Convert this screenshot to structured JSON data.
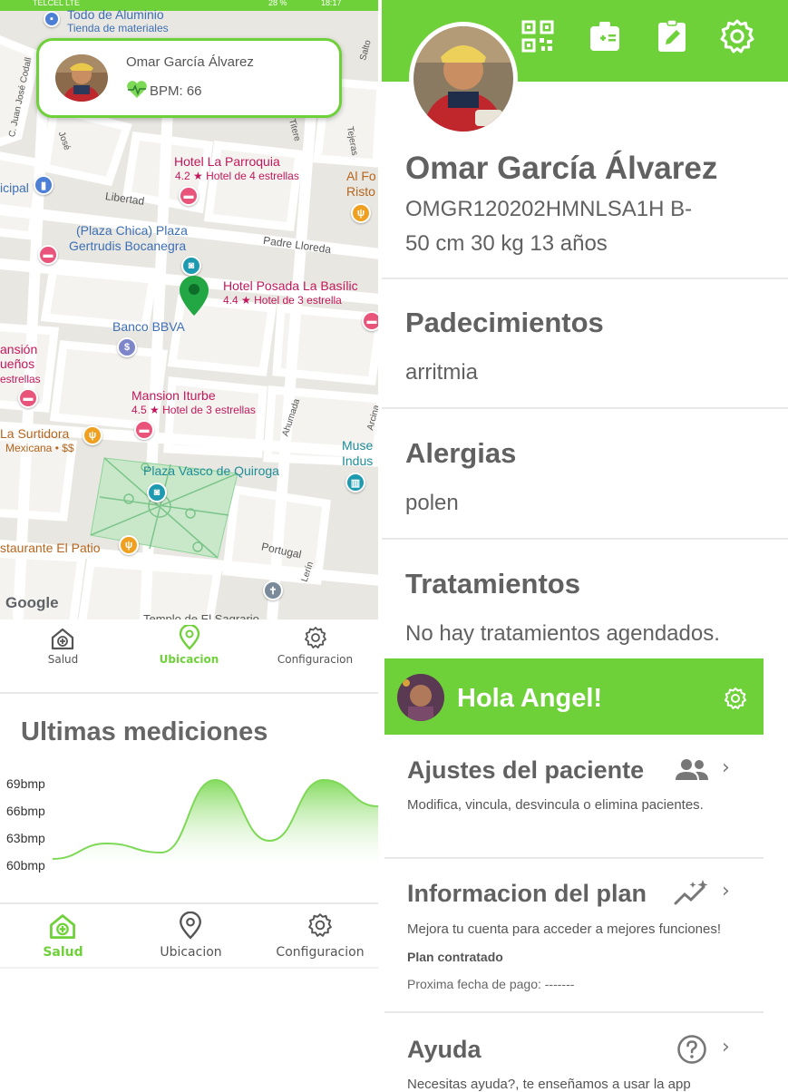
{
  "status_bar": {
    "carrier": "TELCEL LTE",
    "battery": "28 %",
    "time": "18:17"
  },
  "map": {
    "patient_card": {
      "name": "Omar García Álvarez",
      "bpm": "BPM: 66"
    },
    "labels": {
      "todo_aluminio": "Todo de Aluminio",
      "tienda": "Tienda de materiales",
      "hotel_parroquia": "Hotel La Parroquia",
      "hotel_parroquia_sub": "4.2 ★ Hotel de 4 estrellas",
      "al_fo": "Al Fo",
      "risto": "Risto",
      "icipal": "icipal",
      "plaza_chica_1": "(Plaza Chica) Plaza",
      "plaza_chica_2": "Gertrudis Bocanegra",
      "hotel_posada": "Hotel Posada La Basílic",
      "hotel_posada_sub": "4.4 ★ Hotel de 3 estrella",
      "banco": "Banco BBVA",
      "ansion": "ansión",
      "suenos": "ueños",
      "estrellas": "estrellas",
      "mansion": "Mansion Iturbe",
      "mansion_sub": "4.5 ★ Hotel de 3 estrellas",
      "surtidora": "La Surtidora",
      "surtidora_sub": "Mexicana • $$",
      "museo_1": "Muse",
      "museo_2": "Indus",
      "plaza_vasco": "Plaza Vasco de Quiroga",
      "patio": "staurante El Patio",
      "templo": "Templo de El Sagrario",
      "google": "Google"
    },
    "streets": {
      "juan_jose": "C. Juan José Codall",
      "jose": "José",
      "salto": "Salto",
      "titere": "Titere",
      "tejeras": "Tejeras",
      "libertad": "Libertad",
      "padre": "Padre Lloreda",
      "ahumada": "Ahumada",
      "arcina": "Arcina",
      "portugal": "Portugal",
      "lerin": "Lerín"
    }
  },
  "nav_top": [
    {
      "label": "Salud",
      "icon": "health-house-icon",
      "active": false
    },
    {
      "label": "Ubicacion",
      "icon": "location-pin-icon",
      "active": true
    },
    {
      "label": "Configuracion",
      "icon": "gear-icon",
      "active": false
    }
  ],
  "mediciones": {
    "title": "Ultimas mediciones"
  },
  "chart_data": {
    "type": "area",
    "title": "Ultimas mediciones",
    "ylabel": "",
    "xlabel": "",
    "y_ticks": [
      "69bmp",
      "66bmp",
      "63bmp",
      "60bmp"
    ],
    "ylim": [
      60,
      69
    ],
    "x": [
      0,
      1,
      2,
      3,
      4,
      5,
      6
    ],
    "series": [
      {
        "values": [
          60.3,
          62.0,
          61.0,
          69.0,
          62.3,
          69.0,
          66.1
        ]
      }
    ],
    "colors": {
      "line": "#7ed957",
      "fill_top": "#7ed957",
      "fill_bottom": "#ffffff"
    },
    "grid": false
  },
  "nav_bottom": [
    {
      "label": "Salud",
      "icon": "health-house-icon",
      "active": true
    },
    {
      "label": "Ubicacion",
      "icon": "location-pin-icon",
      "active": false
    },
    {
      "label": "Configuracion",
      "icon": "gear-icon",
      "active": false
    }
  ],
  "profile": {
    "header_icons": [
      "qr-code-icon",
      "medical-id-icon",
      "edit-clipboard-icon",
      "gear-icon"
    ],
    "name": "Omar García Álvarez",
    "id_line": "OMGR120202HMNLSA1H   B-",
    "stats_line": "50 cm   30 kg   13 años",
    "sections": [
      {
        "title": "Padecimientos",
        "value": "arritmia"
      },
      {
        "title": "Alergias",
        "value": "polen"
      },
      {
        "title": "Tratamientos",
        "value": "No hay tratamientos agendados."
      }
    ]
  },
  "settings": {
    "greeting": "Hola Angel!",
    "items": [
      {
        "title": "Ajustes del paciente",
        "icon": "people-icon",
        "desc": "Modifica, vincula, desvincula o elimina pacientes."
      },
      {
        "title": "Informacion del plan",
        "icon": "sparkle-chart-icon",
        "desc": "Mejora tu cuenta para acceder a mejores funciones!",
        "plan_label": "Plan contratado",
        "next_payment": "Proxima fecha de pago: -------"
      },
      {
        "title": "Ayuda",
        "icon": "help-circle-icon",
        "desc": "Necesitas ayuda?, te enseñamos a usar la app"
      }
    ]
  },
  "colors": {
    "accent": "#6fd13a",
    "text": "#616161",
    "map_pin": "#22a744"
  }
}
